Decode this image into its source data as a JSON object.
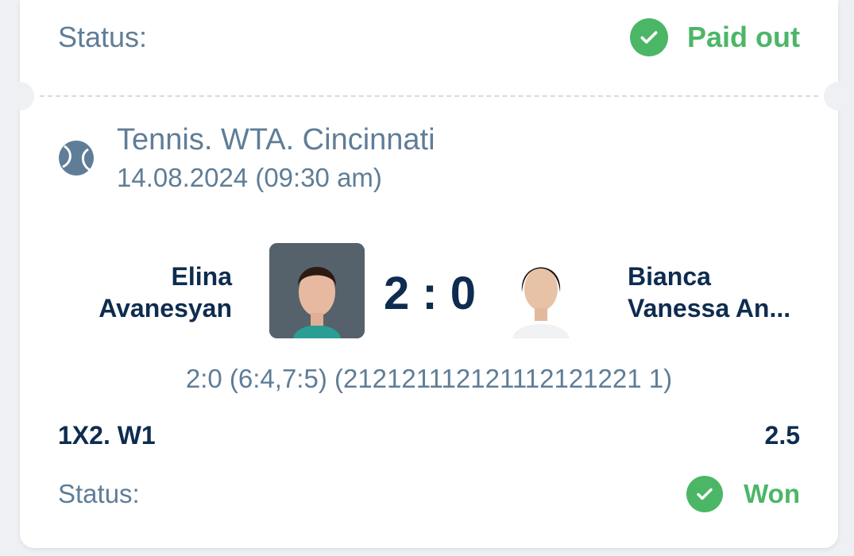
{
  "status_top": {
    "label": "Status:",
    "value": "Paid out",
    "icon": "check-circle-icon"
  },
  "event": {
    "sport_icon": "tennis-ball-icon",
    "title": "Tennis. WTA. Cincinnati",
    "date": "14.08.2024 (09:30 am)"
  },
  "match": {
    "home": {
      "first": "Elina",
      "last": "Avanesyan"
    },
    "away": {
      "first": "Bianca",
      "last": "Vanessa An..."
    },
    "score": "2 : 0",
    "detail": "2:0 (6:4,7:5) (212121112121112121221 1)"
  },
  "bet": {
    "market": "1X2. W1",
    "odds": "2.5"
  },
  "status_bottom": {
    "label": "Status:",
    "value": "Won",
    "icon": "check-circle-icon"
  },
  "colors": {
    "accent_green": "#4cb667",
    "muted": "#5f7d97",
    "dark": "#0e2c4f"
  }
}
